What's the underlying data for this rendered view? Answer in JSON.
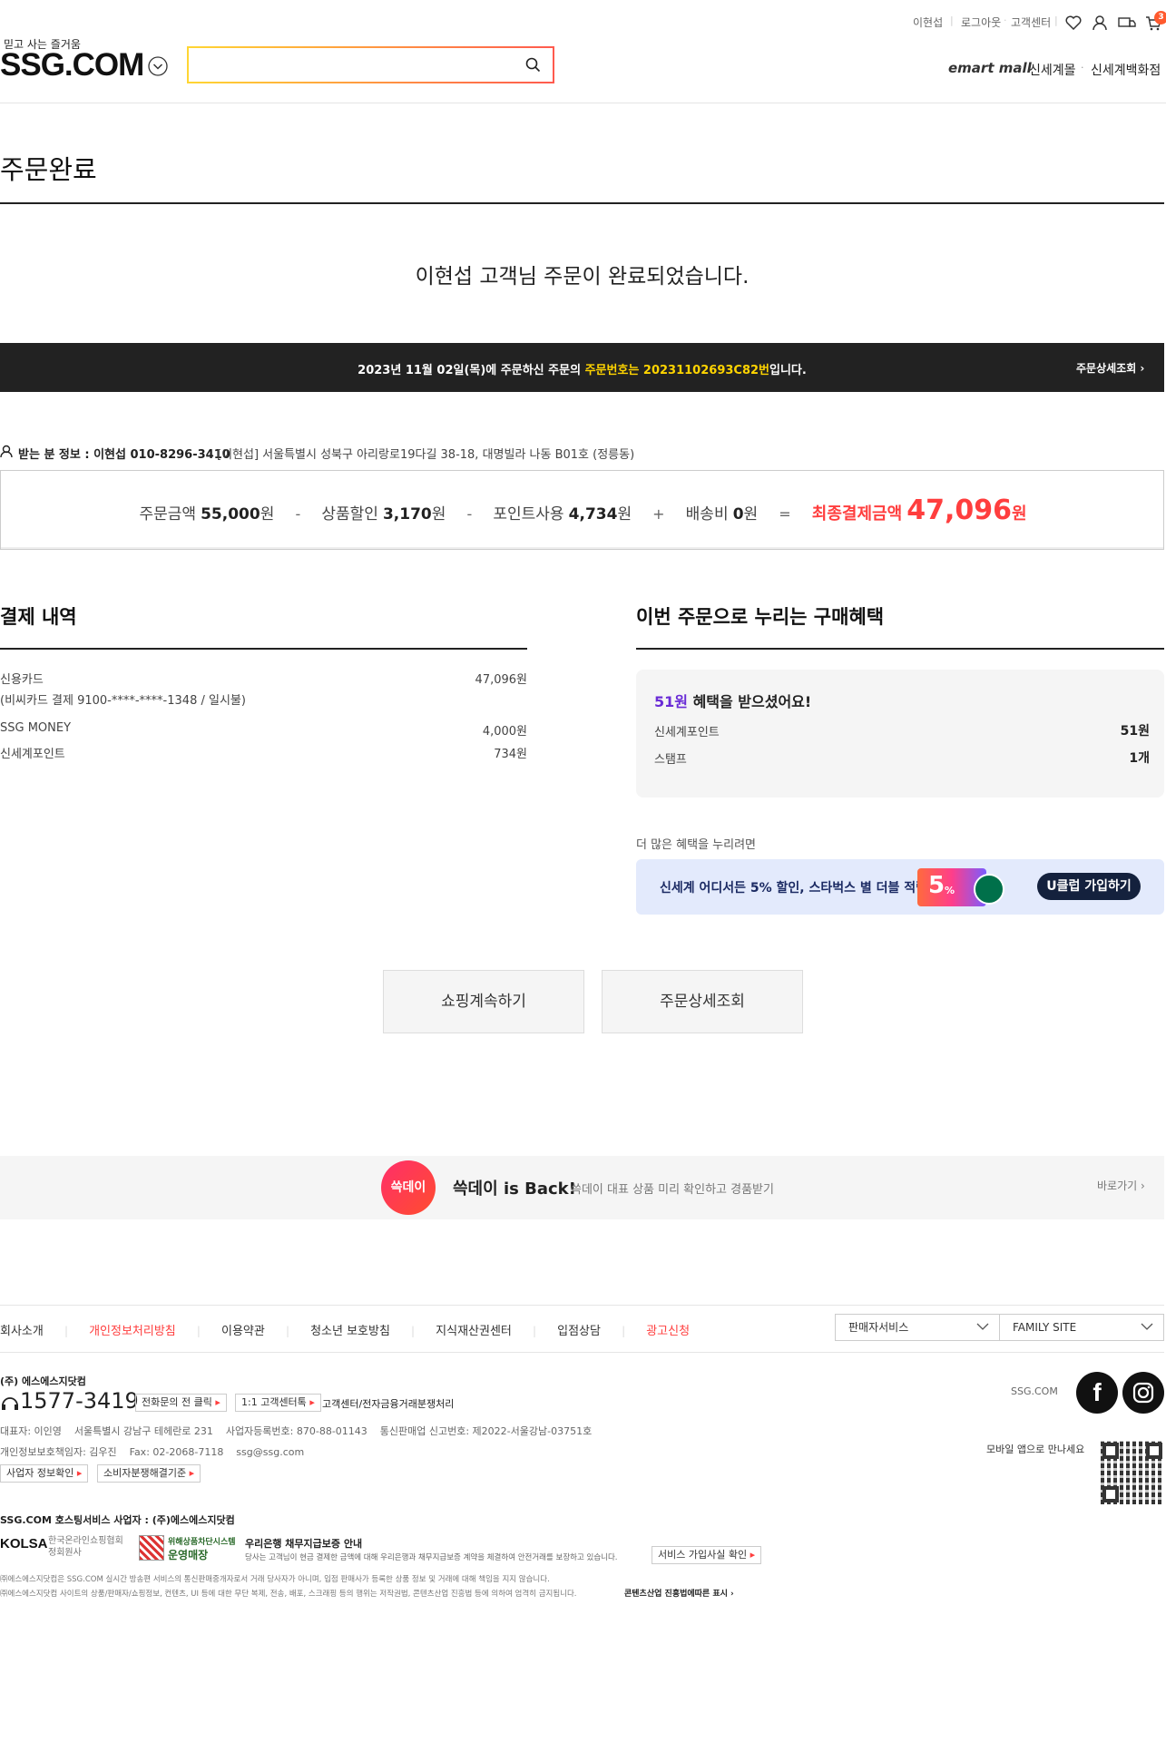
{
  "header": {
    "util": [
      "이현섭",
      "로그아웃",
      "고객센터"
    ],
    "tagline": "믿고 사는 즐거움",
    "logo": "SSG.COM",
    "search_value": "",
    "cart_count": "3",
    "malls": [
      "emart mall",
      "신세계몰",
      "신세계백화점"
    ]
  },
  "page_title": "주문완료",
  "complete_message": "이현섭 고객님 주문이 완료되었습니다.",
  "order_bar": {
    "prefix": "2023년 11월 02일(목)에 주문하신 주문의 ",
    "highlight": "주문번호는 20231102693C82번",
    "suffix": "입니다.",
    "detail_link": "주문상세조회"
  },
  "receiver": {
    "label": "받는 분 정보 : 이현섭 010-8296-3410",
    "address": "[이현섭] 서울특별시 성북구 아리랑로19다길 38-18, 대명빌라 나동 B01호 (정릉동)"
  },
  "summary": {
    "order_label": "주문금액",
    "order_value": "55,000",
    "won": "원",
    "discount_label": "상품할인",
    "discount_value": "3,170",
    "point_label": "포인트사용",
    "point_value": "4,734",
    "ship_label": "배송비",
    "ship_value": "0",
    "minus": "-",
    "plus": "+",
    "equals": "=",
    "final_label": "최종결제금액",
    "final_value": "47,096"
  },
  "payment": {
    "title": "결제 내역",
    "rows": [
      {
        "label": "신용카드",
        "value": "47,096원"
      },
      {
        "label": "(비씨카드 결제 9100-****-****-1348 / 일시불)",
        "value": ""
      },
      {
        "label": "SSG MONEY",
        "value": "4,000원"
      },
      {
        "label": "신세계포인트",
        "value": "734원"
      }
    ]
  },
  "benefits": {
    "title": "이번 주문으로 누리는 구매혜택",
    "amount": "51원",
    "headline": " 혜택을 받으셨어요!",
    "rows": [
      {
        "label": "신세계포인트",
        "value": "51원"
      },
      {
        "label": "스탬프",
        "value": "1개"
      }
    ],
    "more": "더 많은 혜택을 누리려면",
    "uclub_text": "신세계 어디서든 5% 할인, 스타벅스 별 더블 적립",
    "uclub_percent": "5",
    "uclub_percent_sign": "%",
    "uclub_button": "U클럽 가입하기"
  },
  "buttons": {
    "continue": "쇼핑계속하기",
    "detail": "주문상세조회"
  },
  "sseukday": {
    "badge": "쓱데이",
    "title": "쓱데이 is Back!",
    "subtitle": "쓱데이 대표 상품 미리 확인하고 경품받기",
    "go": "바로가기"
  },
  "footer": {
    "links": [
      "회사소개",
      "개인정보처리방침",
      "이용약관",
      "청소년 보호방침",
      "지식재산권센터",
      "입점상담",
      "광고신청"
    ],
    "seller_select": "판매자서비스",
    "family_select": "FAMILY SITE",
    "company": "(주) 에스에스지닷컴",
    "tel": "1577-3419",
    "chips": [
      "전화문의 전 클릭",
      "1:1 고객센터톡",
      "사업자 정보확인",
      "소비자분쟁해결기준",
      "서비스 가입사실 확인"
    ],
    "center": "고객센터/전자금융거래분쟁처리",
    "info1": "대표자: 이인영    서울특별시 강남구 테헤란로 231    사업자등록번호: 870-88-01143    통신판매업 신고번호: 제2022-서울강남-03751호",
    "info2": "개인정보보호책임자: 김우진    Fax: 02-2068-7118    ssg@ssg.com",
    "ssg_label": "SSG.COM",
    "mobile_label": "모바일 앱으로 만나세요",
    "hosting": "SSG.COM 호스팅서비스 사업자 : (주)에스에스지닷컴",
    "kolsa": "KOLSA",
    "kolsa_text": "한국온라인쇼핑협회 정회원사",
    "cert_title": "위해상품차단시스템",
    "cert_label": "운영매장",
    "bank_title": "우리은행 채무지급보증 안내",
    "bank_text": "당사는 고객님이 현금 결제한 금액에 대해 우리은행과 채무지급보증 계약을 체결하여 안전거래를 보장하고 있습니다.",
    "notice1": "㈜에스에스지닷컴은 SSG.COM 실시간 방송편 서비스의 통신판매중개자로서 거래 당사자가 아니며, 입점 판매사가 등록한 상품 정보 및 거래에 대해 책임을 지지 않습니다.",
    "notice2": "㈜에스에스지닷컴 사이트의 상품/판매자/쇼핑정보, 컨텐츠, UI 등에 대한 무단 복제, 전송, 배포, 스크래핑 등의 행위는 저작권법, 콘텐츠산업 진흥법 등에 의하여 엄격히 금지됩니다.",
    "notice_link": "콘텐츠산업 진흥법에따른 표시"
  }
}
